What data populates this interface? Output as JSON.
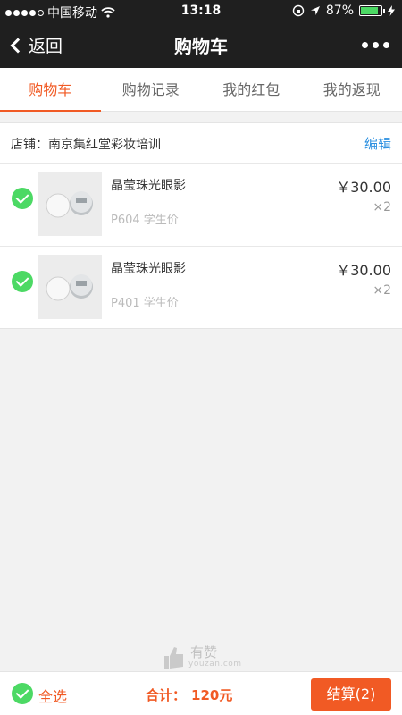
{
  "status_bar": {
    "carrier": "中国移动",
    "time": "13:18",
    "battery": "87%",
    "battery_fraction": 0.87
  },
  "nav": {
    "back_label": "返回",
    "title": "购物车"
  },
  "tabs": [
    {
      "label": "购物车",
      "active": true
    },
    {
      "label": "购物记录",
      "active": false
    },
    {
      "label": "我的红包",
      "active": false
    },
    {
      "label": "我的返现",
      "active": false
    }
  ],
  "shop": {
    "label": "店铺：南京集红堂彩妆培训",
    "edit_label": "编辑"
  },
  "items": [
    {
      "name": "晶莹珠光眼影",
      "sku": "P604   学生价",
      "price": "￥30.00",
      "qty": "×2"
    },
    {
      "name": "晶莹珠光眼影",
      "sku": "P401   学生价",
      "price": "￥30.00",
      "qty": "×2"
    }
  ],
  "watermark": {
    "title": "有赞",
    "url": "youzan.com"
  },
  "bottom": {
    "select_all_label": "全选",
    "total_label": "合计：",
    "total_amount": "120元",
    "checkout_label": "结算(2)"
  },
  "colors": {
    "accent": "#f15a24",
    "check": "#4cd964",
    "link": "#2a8fe0",
    "nav_bg": "#1f1f1f"
  }
}
